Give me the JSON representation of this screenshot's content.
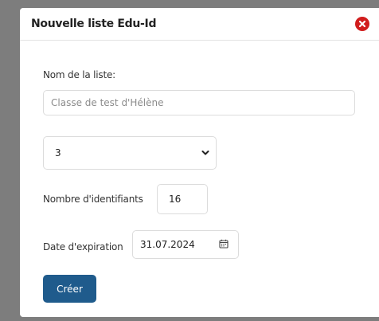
{
  "dialog": {
    "title": "Nouvelle liste Edu-Id",
    "list_name_label": "Nom de la liste:",
    "list_name_value": "Classe de test d'Hélène",
    "select_value": "3",
    "count_label": "Nombre d'identifiants",
    "count_value": "16",
    "expiration_label": "Date d'expiration",
    "expiration_value": "31.07.2024",
    "create_label": "Créer"
  },
  "icons": {
    "close": "close-icon",
    "select_arrow": "chevron-down-icon",
    "calendar": "calendar-icon"
  },
  "colors": {
    "close": "#d11d1d",
    "primary_button": "#1f5b8c",
    "overlay": "#7d7d7d"
  }
}
